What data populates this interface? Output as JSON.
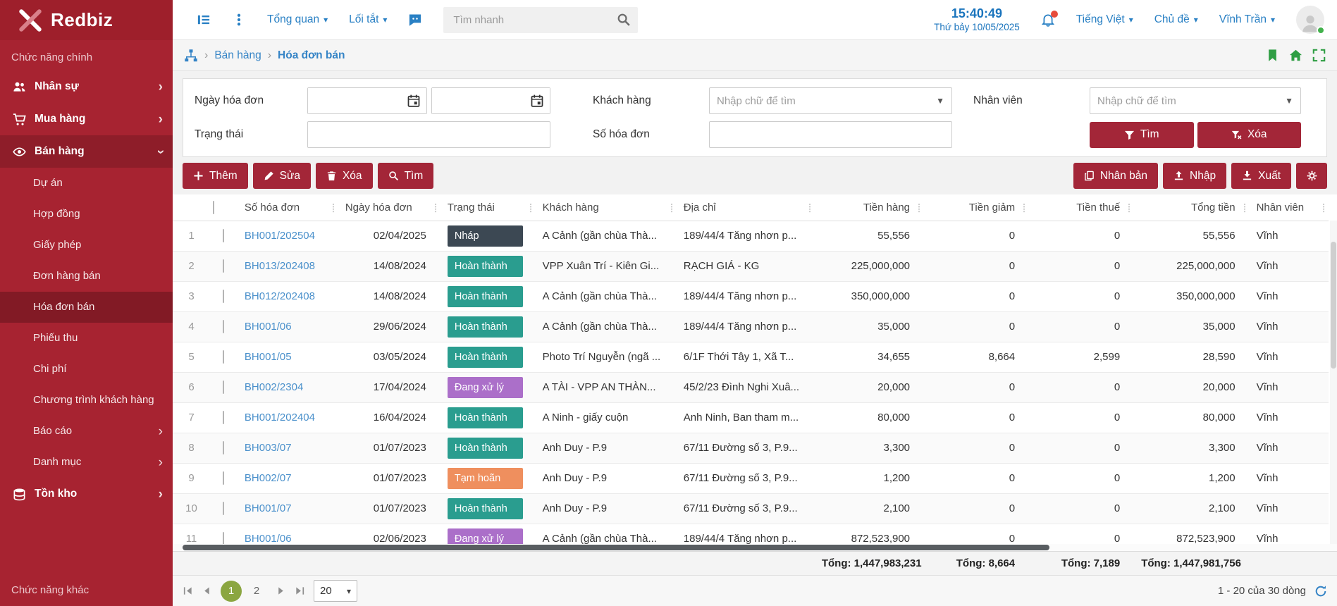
{
  "app": {
    "name": "Redbiz"
  },
  "topbar": {
    "nav_overview": "Tổng quan",
    "nav_shortcuts": "Lối tắt",
    "search_placeholder": "Tìm nhanh",
    "time": "15:40:49",
    "date": "Thứ bảy 10/05/2025",
    "language": "Tiếng Việt",
    "theme": "Chủ đề",
    "user": "Vĩnh Trần"
  },
  "breadcrumb": {
    "level1": "Bán hàng",
    "level2": "Hóa đơn bán"
  },
  "sidebar": {
    "section_main": "Chức năng chính",
    "section_other": "Chức năng khác",
    "menu": [
      {
        "label": "Nhân sự",
        "type": "top",
        "icon": "people-icon",
        "chevron": "right"
      },
      {
        "label": "Mua hàng",
        "type": "top",
        "icon": "cart-icon",
        "chevron": "right"
      },
      {
        "label": "Bán hàng",
        "type": "top",
        "icon": "eye-icon",
        "chevron": "down",
        "active": true
      },
      {
        "label": "Dự án",
        "type": "sub"
      },
      {
        "label": "Hợp đồng",
        "type": "sub"
      },
      {
        "label": "Giấy phép",
        "type": "sub"
      },
      {
        "label": "Đơn hàng bán",
        "type": "sub"
      },
      {
        "label": "Hóa đơn bán",
        "type": "sub",
        "active": true
      },
      {
        "label": "Phiếu thu",
        "type": "sub"
      },
      {
        "label": "Chi phí",
        "type": "sub"
      },
      {
        "label": "Chương trình khách hàng",
        "type": "sub"
      },
      {
        "label": "Báo cáo",
        "type": "sub",
        "chevron": "right"
      },
      {
        "label": "Danh mục",
        "type": "sub",
        "chevron": "right"
      },
      {
        "label": "Tồn kho",
        "type": "top",
        "icon": "stack-icon",
        "chevron": "right"
      }
    ]
  },
  "filters": {
    "date_label": "Ngày hóa đơn",
    "customer_label": "Khách hàng",
    "employee_label": "Nhân viên",
    "status_label": "Trạng thái",
    "invoice_no_label": "Số hóa đơn",
    "combo_placeholder": "Nhập chữ để tìm",
    "find_button": "Tìm",
    "clear_button": "Xóa"
  },
  "toolbar": {
    "left": [
      {
        "label": "Thêm",
        "icon": "plus-icon"
      },
      {
        "label": "Sửa",
        "icon": "pencil-icon"
      },
      {
        "label": "Xóa",
        "icon": "trash-icon"
      },
      {
        "label": "Tìm",
        "icon": "search-icon"
      }
    ],
    "right": [
      {
        "label": "Nhân bản",
        "icon": "copy-icon"
      },
      {
        "label": "Nhập",
        "icon": "upload-icon"
      },
      {
        "label": "Xuất",
        "icon": "download-icon"
      },
      {
        "label": "",
        "icon": "gear-icon"
      }
    ]
  },
  "table": {
    "columns": [
      "",
      "",
      "Số hóa đơn",
      "Ngày hóa đơn",
      "Trạng thái",
      "Khách hàng",
      "Địa chỉ",
      "Tiền hàng",
      "Tiền giảm",
      "Tiền thuế",
      "Tổng tiền",
      "Nhân viên"
    ],
    "rows": [
      {
        "no": "1",
        "invoice": "BH001/202504",
        "date": "02/04/2025",
        "status": "Nháp",
        "status_key": "draft",
        "customer": "A Cảnh (gần chùa Thà...",
        "address": "189/44/4 Tăng nhơn p...",
        "amount": "55,556",
        "discount": "0",
        "tax": "0",
        "total": "55,556",
        "employee": "Vĩnh"
      },
      {
        "no": "2",
        "invoice": "BH013/202408",
        "date": "14/08/2024",
        "status": "Hoàn thành",
        "status_key": "done",
        "customer": "VPP Xuân Trí - Kiên Gi...",
        "address": "RẠCH GIÁ - KG",
        "amount": "225,000,000",
        "discount": "0",
        "tax": "0",
        "total": "225,000,000",
        "employee": "Vĩnh"
      },
      {
        "no": "3",
        "invoice": "BH012/202408",
        "date": "14/08/2024",
        "status": "Hoàn thành",
        "status_key": "done",
        "customer": "A Cảnh (gần chùa Thà...",
        "address": "189/44/4 Tăng nhơn p...",
        "amount": "350,000,000",
        "discount": "0",
        "tax": "0",
        "total": "350,000,000",
        "employee": "Vĩnh"
      },
      {
        "no": "4",
        "invoice": "BH001/06",
        "date": "29/06/2024",
        "status": "Hoàn thành",
        "status_key": "done",
        "customer": "A Cảnh (gần chùa Thà...",
        "address": "189/44/4 Tăng nhơn p...",
        "amount": "35,000",
        "discount": "0",
        "tax": "0",
        "total": "35,000",
        "employee": "Vĩnh"
      },
      {
        "no": "5",
        "invoice": "BH001/05",
        "date": "03/05/2024",
        "status": "Hoàn thành",
        "status_key": "done",
        "customer": "Photo Trí Nguyễn (ngã ...",
        "address": "6/1F Thới Tây 1, Xã T...",
        "amount": "34,655",
        "discount": "8,664",
        "tax": "2,599",
        "total": "28,590",
        "employee": "Vĩnh"
      },
      {
        "no": "6",
        "invoice": "BH002/2304",
        "date": "17/04/2024",
        "status": "Đang xử lý",
        "status_key": "processing",
        "customer": "A TÀI - VPP AN THÀN...",
        "address": "45/2/23 Đình Nghi Xuâ...",
        "amount": "20,000",
        "discount": "0",
        "tax": "0",
        "total": "20,000",
        "employee": "Vĩnh"
      },
      {
        "no": "7",
        "invoice": "BH001/202404",
        "date": "16/04/2024",
        "status": "Hoàn thành",
        "status_key": "done",
        "customer": "A Ninh - giấy cuộn",
        "address": "Anh Ninh, Ban tham m...",
        "amount": "80,000",
        "discount": "0",
        "tax": "0",
        "total": "80,000",
        "employee": "Vĩnh"
      },
      {
        "no": "8",
        "invoice": "BH003/07",
        "date": "01/07/2023",
        "status": "Hoàn thành",
        "status_key": "done",
        "customer": "Anh Duy - P.9",
        "address": "67/11 Đường số 3, P.9...",
        "amount": "3,300",
        "discount": "0",
        "tax": "0",
        "total": "3,300",
        "employee": "Vĩnh"
      },
      {
        "no": "9",
        "invoice": "BH002/07",
        "date": "01/07/2023",
        "status": "Tạm hoãn",
        "status_key": "paused",
        "customer": "Anh Duy - P.9",
        "address": "67/11 Đường số 3, P.9...",
        "amount": "1,200",
        "discount": "0",
        "tax": "0",
        "total": "1,200",
        "employee": "Vĩnh"
      },
      {
        "no": "10",
        "invoice": "BH001/07",
        "date": "01/07/2023",
        "status": "Hoàn thành",
        "status_key": "done",
        "customer": "Anh Duy - P.9",
        "address": "67/11 Đường số 3, P.9...",
        "amount": "2,100",
        "discount": "0",
        "tax": "0",
        "total": "2,100",
        "employee": "Vĩnh"
      },
      {
        "no": "11",
        "invoice": "BH001/06",
        "date": "02/06/2023",
        "status": "Đang xử lý",
        "status_key": "processing",
        "customer": "A Cảnh (gần chùa Thà...",
        "address": "189/44/4 Tăng nhơn p...",
        "amount": "872,523,900",
        "discount": "0",
        "tax": "0",
        "total": "872,523,900",
        "employee": "Vĩnh"
      }
    ],
    "totals": {
      "amount": "Tổng: 1,447,983,231",
      "discount": "Tổng: 8,664",
      "tax": "Tổng: 7,189",
      "total": "Tổng: 1,447,981,756"
    }
  },
  "pagination": {
    "pages": [
      "1",
      "2"
    ],
    "active": "1",
    "page_size": "20",
    "range_label": "1 - 20 của 30 dòng"
  },
  "colors": {
    "brand_red": "#a32638",
    "sidebar_bg": "#a72331",
    "link_blue": "#2980c4",
    "table_link": "#4a90cb",
    "green_icons": "#2f9e44",
    "pager_active_green": "#8ba641",
    "status": {
      "draft": "#3c4853",
      "done": "#2a9d8f",
      "processing": "#ab6fc9",
      "paused": "#ef8f5e"
    }
  }
}
